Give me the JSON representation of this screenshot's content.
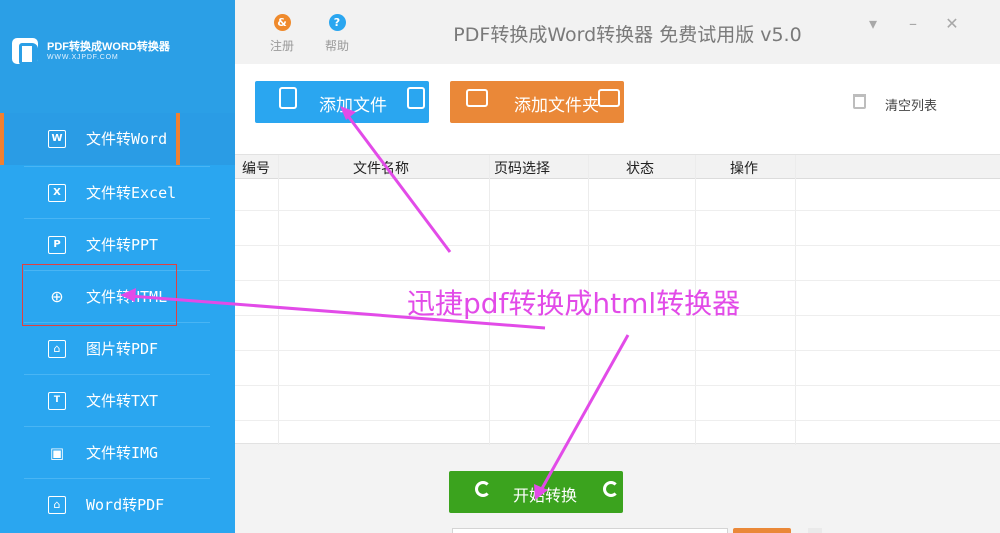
{
  "app": {
    "logo_text": "PDF转换成WORD转换器",
    "logo_url": "WWW.XJPDF.COM",
    "title": "PDF转换成Word转换器 免费试用版 v5.0"
  },
  "titlebar": {
    "register_label": "注册",
    "help_label": "帮助",
    "help_icon_glyph": "?",
    "register_icon_glyph": "&"
  },
  "window_controls": {
    "menu_glyph": "▾",
    "minimize_glyph": "–",
    "close_glyph": "✕"
  },
  "sidebar": {
    "items": [
      {
        "label": "文件转Word",
        "icon": "word-doc-icon",
        "glyph": "W",
        "active": true
      },
      {
        "label": "文件转Excel",
        "icon": "excel-doc-icon",
        "glyph": "X",
        "active": false
      },
      {
        "label": "文件转PPT",
        "icon": "ppt-doc-icon",
        "glyph": "P",
        "active": false
      },
      {
        "label": "文件转HTML",
        "icon": "globe-icon",
        "glyph": "⊕",
        "active": false
      },
      {
        "label": "图片转PDF",
        "icon": "pdf-icon",
        "glyph": "⌂",
        "active": false
      },
      {
        "label": "文件转TXT",
        "icon": "txt-icon",
        "glyph": "T",
        "active": false
      },
      {
        "label": "文件转IMG",
        "icon": "image-icon",
        "glyph": "▣",
        "active": false
      },
      {
        "label": "Word转PDF",
        "icon": "pdf-icon",
        "glyph": "⌂",
        "active": false
      }
    ]
  },
  "toolbar": {
    "add_file_label": "添加文件",
    "add_folder_label": "添加文件夹",
    "clear_list_label": "清空列表"
  },
  "table": {
    "columns": [
      "编号",
      "文件名称",
      "页码选择",
      "状态",
      "操作"
    ],
    "rows": []
  },
  "bottom": {
    "start_label": "开始转换"
  },
  "annotation": {
    "text": "迅捷pdf转换成html转换器",
    "color": "#e24be8"
  },
  "colors": {
    "sidebar_bg": "#2aa6f0",
    "accent_orange": "#ea8838",
    "start_green": "#3ba31e",
    "active_indicator": "#f08030"
  }
}
